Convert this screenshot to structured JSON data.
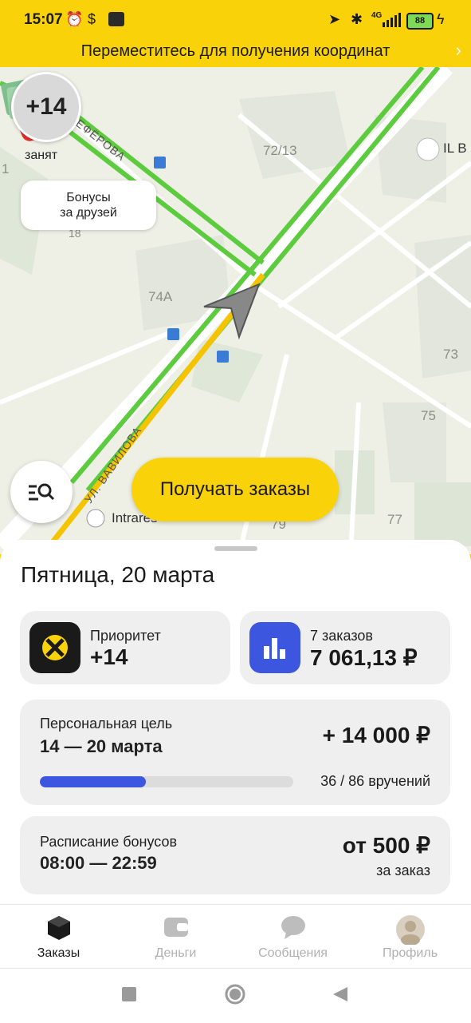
{
  "status_bar": {
    "time": "15:07",
    "battery": "88",
    "network": "4G"
  },
  "banner": {
    "text": "Переместитесь для получения координат"
  },
  "map": {
    "labels": {
      "street1": "ЧЕФЁРОВА",
      "street2": "УЛ. ВАВИЛОВА",
      "n7213": "72/13",
      "n74a": "74А",
      "n18": "18",
      "n73": "73",
      "n75": "75",
      "n77": "77",
      "n79": "79",
      "n1": "1",
      "poi1": "IL B",
      "poi2": "Intrares"
    },
    "priority_badge": "+14",
    "status": "занят",
    "bonus_bubble": {
      "line1": "Бонусы",
      "line2": "за друзей"
    },
    "cta_label": "Получать заказы"
  },
  "sheet": {
    "date": "Пятница, 20 марта",
    "priority_card": {
      "label": "Приоритет",
      "value": "+14"
    },
    "orders_card": {
      "label": "7 заказов",
      "value": "7 061,13 ₽"
    },
    "goal_card": {
      "title": "Персональная цель",
      "period": "14 — 20 марта",
      "reward": "+ 14 000 ₽",
      "progress_text": "36 / 86 вручений",
      "progress_done": 36,
      "progress_total": 86
    },
    "bonus_card": {
      "title": "Расписание бонусов",
      "hours": "08:00 — 22:59",
      "amount": "от 500 ₽",
      "per": "за заказ"
    }
  },
  "tabs": [
    {
      "label": "Заказы",
      "icon": "orders-icon",
      "active": true
    },
    {
      "label": "Деньги",
      "icon": "wallet-icon",
      "active": false
    },
    {
      "label": "Сообщения",
      "icon": "chat-icon",
      "active": false
    },
    {
      "label": "Профиль",
      "icon": "avatar",
      "active": false
    }
  ],
  "colors": {
    "accent": "#fad20a",
    "progress": "#3c56e0",
    "route_green": "#5ccc3e",
    "route_yellow": "#f5c400"
  }
}
